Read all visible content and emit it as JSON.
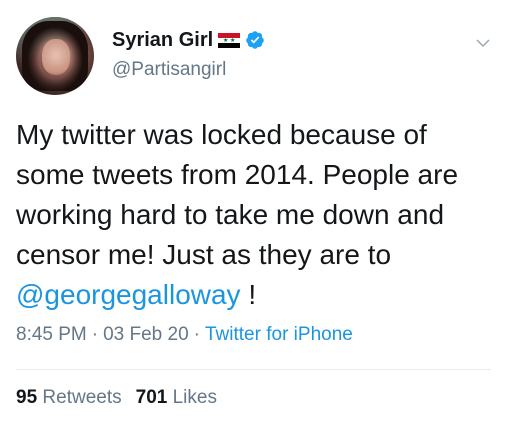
{
  "user": {
    "display_name": "Syrian Girl",
    "handle": "@Partisangirl",
    "flag_icon": "syria-flag-icon",
    "verified_icon": "verified-badge-icon"
  },
  "tweet": {
    "text_before": "My twitter was locked because of some tweets from 2014. People are working hard to take me down and censor me! Just as they are to ",
    "mention": "@georgegalloway",
    "text_after": " !",
    "time": "8:45 PM",
    "separator": "·",
    "date": "03 Feb 20",
    "source": "Twitter for iPhone"
  },
  "stats": {
    "retweets_count": "95",
    "retweets_label": "Retweets",
    "likes_count": "701",
    "likes_label": "Likes"
  },
  "colors": {
    "text": "#14171a",
    "secondary": "#657786",
    "link": "#1b95e0",
    "verified": "#1da1f2",
    "divider": "#e6ecf0"
  }
}
